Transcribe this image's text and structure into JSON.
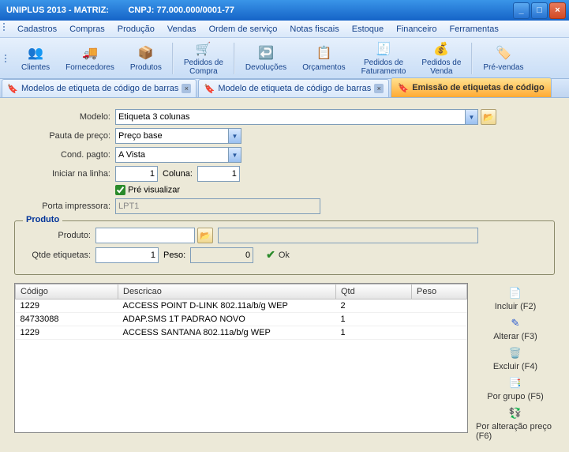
{
  "window": {
    "title": "UNIPLUS 2013 - MATRIZ:",
    "cnpj_label": "CNPJ: 77.000.000/0001-77"
  },
  "menu": {
    "items": [
      "Cadastros",
      "Compras",
      "Produção",
      "Vendas",
      "Ordem de serviço",
      "Notas fiscais",
      "Estoque",
      "Financeiro",
      "Ferramentas"
    ]
  },
  "toolbar": {
    "clientes": "Clientes",
    "fornecedores": "Fornecedores",
    "produtos": "Produtos",
    "pedidos_compra": "Pedidos de\nCompra",
    "devolucoes": "Devoluções",
    "orcamentos": "Orçamentos",
    "pedidos_faturamento": "Pedidos de\nFaturamento",
    "pedidos_venda": "Pedidos de\nVenda",
    "pre_vendas": "Pré-vendas"
  },
  "tabs": {
    "t0": "Modelos de etiqueta de código de barras",
    "t1": "Modelo de etiqueta de código de barras",
    "t2": "Emissão de etiquetas de código"
  },
  "form": {
    "modelo_label": "Modelo:",
    "modelo_value": "Etiqueta 3 colunas",
    "pauta_label": "Pauta de preço:",
    "pauta_value": "Preço base",
    "cond_label": "Cond. pagto:",
    "cond_value": "A Vista",
    "iniciar_label": "Iniciar na linha:",
    "iniciar_value": "1",
    "coluna_label": "Coluna:",
    "coluna_value": "1",
    "pre_vis_label": "Pré visualizar",
    "porta_label": "Porta impressora:",
    "porta_value": "LPT1"
  },
  "produto": {
    "group_title": "Produto",
    "produto_label": "Produto:",
    "produto_value": "",
    "qtde_label": "Qtde etiquetas:",
    "qtde_value": "1",
    "peso_label": "Peso:",
    "peso_value": "0",
    "ok_label": "Ok"
  },
  "grid": {
    "headers": {
      "codigo": "Código",
      "descricao": "Descricao",
      "qtd": "Qtd",
      "peso": "Peso"
    },
    "rows": [
      {
        "codigo": "1229",
        "descricao": "ACCESS POINT D-LINK 802.11a/b/g WEP",
        "qtd": "2",
        "peso": ""
      },
      {
        "codigo": "84733088",
        "descricao": "ADAP.SMS 1T PADRAO NOVO",
        "qtd": "1",
        "peso": ""
      },
      {
        "codigo": "1229",
        "descricao": "ACCESS SANTANA 802.11a/b/g WEP",
        "qtd": "1",
        "peso": ""
      }
    ]
  },
  "side": {
    "incluir": "Incluir (F2)",
    "alterar": "Alterar (F3)",
    "excluir": "Excluir (F4)",
    "por_grupo": "Por grupo (F5)",
    "por_alt_preco": "Por alteração preço (F6)"
  }
}
